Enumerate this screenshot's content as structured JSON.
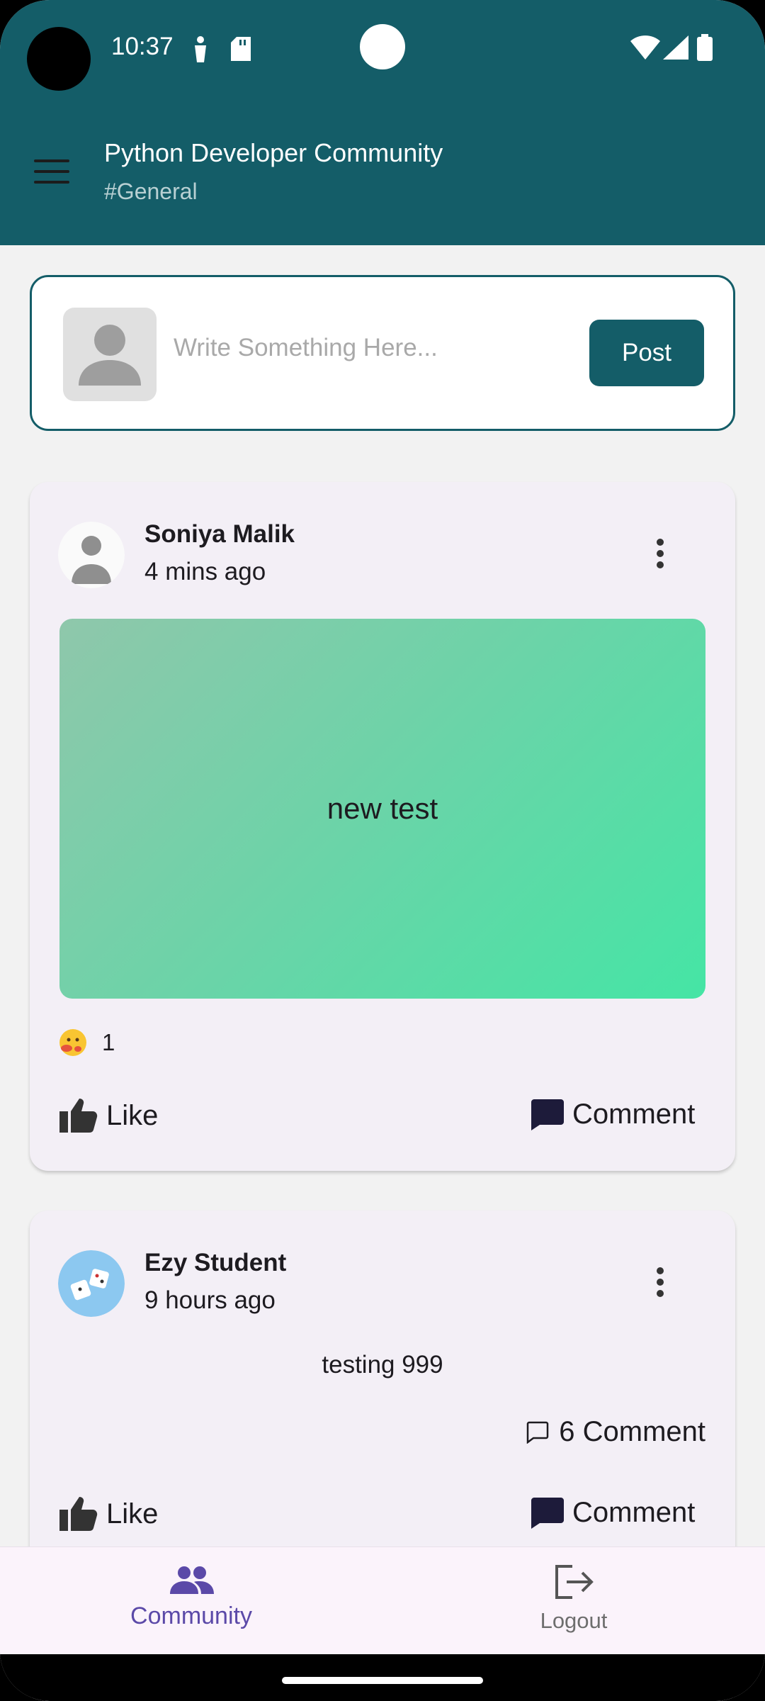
{
  "status_bar": {
    "time": "10:37"
  },
  "header": {
    "title": "Python Developer Community",
    "subtitle": "#General"
  },
  "composer": {
    "placeholder": "Write Something Here...",
    "post_label": "Post"
  },
  "posts": [
    {
      "author": "Soniya Malik",
      "time": "4 mins ago",
      "content": "new test",
      "reaction_count": "1",
      "like_label": "Like",
      "comment_label": "Comment"
    },
    {
      "author": "Ezy Student",
      "time": "9 hours ago",
      "content": "testing 999",
      "comment_count_label": "6 Comment",
      "like_label": "Like",
      "comment_label": "Comment"
    }
  ],
  "bottom_nav": {
    "community_label": "Community",
    "logout_label": "Logout"
  },
  "colors": {
    "primary": "#145d68",
    "nav_active": "#5b49a8",
    "card_bg": "#f3eff6"
  },
  "icons": [
    "menu-icon",
    "person-icon",
    "more-vert-icon",
    "thumb-up-icon",
    "comment-icon",
    "chat-bubble-outline-icon",
    "group-icon",
    "logout-icon",
    "emoji-icon"
  ]
}
